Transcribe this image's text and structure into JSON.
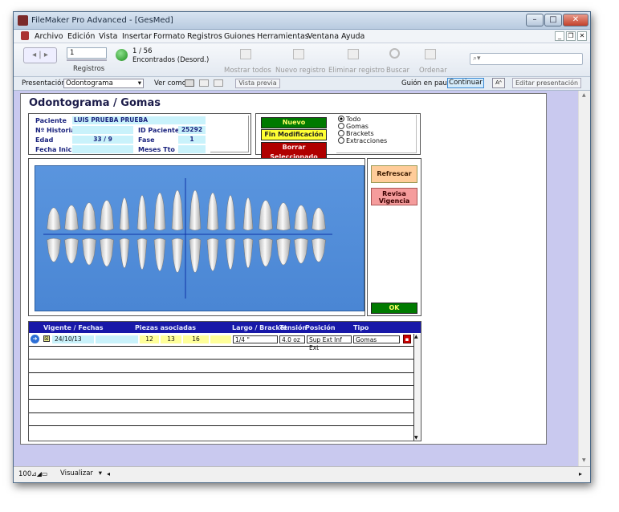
{
  "window": {
    "title": "FileMaker Pro Advanced - [GesMed]"
  },
  "menubar": [
    "Archivo",
    "Edición",
    "Vista",
    "Insertar",
    "Formato",
    "Registros",
    "Guiones",
    "Herramientas",
    "Ventana",
    "Ayuda"
  ],
  "toolbar": {
    "record_input": "1",
    "record_count": "1 / 56",
    "found_status": "Encontrados (Desord.)",
    "records_label": "Registros",
    "show_all": "Mostrar todos",
    "new_record": "Nuevo registro",
    "delete_record": "Eliminar registro",
    "find": "Buscar",
    "sort": "Ordenar"
  },
  "layoutbar": {
    "presentation_label": "Presentación:",
    "presentation_value": "Odontograma",
    "view_as_label": "Ver como:",
    "preview_button": "Vista previa",
    "script_paused": "Guión en pausa",
    "continue_button": "Continuar",
    "aa_button": "Aᴬ",
    "edit_layout_button": "Editar presentación"
  },
  "layout": {
    "title": "Odontograma / Gomas",
    "patient": {
      "paciente_label": "Paciente",
      "paciente_value": "LUIS PRUEBA PRUEBA",
      "historia_label": "Nº Historia",
      "historia_value": "",
      "id_label": "ID Paciente",
      "id_value": "25292",
      "edad_label": "Edad",
      "edad_value": "33 / 9",
      "fase_label": "Fase",
      "fase_value": "1",
      "inicio_label": "Fecha Inicio",
      "inicio_value": "",
      "meses_label": "Meses Tto",
      "meses_value": ""
    },
    "buttons": {
      "nuevo": "Nuevo",
      "fin": "Fin Modificación",
      "borrar": "Borrar Seleccionado"
    },
    "filter": {
      "options": [
        "Todo",
        "Gomas",
        "Brackets",
        "Extracciones"
      ],
      "selected": "Todo"
    },
    "side_buttons": {
      "refresh": "Refrescar",
      "check": "Revisa Vigencia",
      "ok": "OK"
    },
    "table": {
      "headers": [
        "Vigente / Fechas",
        "Piezas asociadas",
        "Largo / Bracket",
        "Tensión",
        "Posición",
        "Tipo"
      ],
      "rows": [
        {
          "date": "24/10/13",
          "p1": "12",
          "p2": "13",
          "p3": "16",
          "largo": "1/4 \"",
          "tension": "4.0 oz",
          "posicion": "Sup Ext Inf Ext",
          "tipo": "Gomas"
        }
      ]
    },
    "colors": {
      "accent": "#0000a0",
      "green": "#007a00",
      "yellow": "#ffff33",
      "red": "#b00000",
      "orange": "#ffcc99",
      "pink": "#f59c9c",
      "cyan": "#c9f2fb"
    }
  },
  "statusbar": {
    "zoom": "100",
    "mode": "Visualizar"
  }
}
